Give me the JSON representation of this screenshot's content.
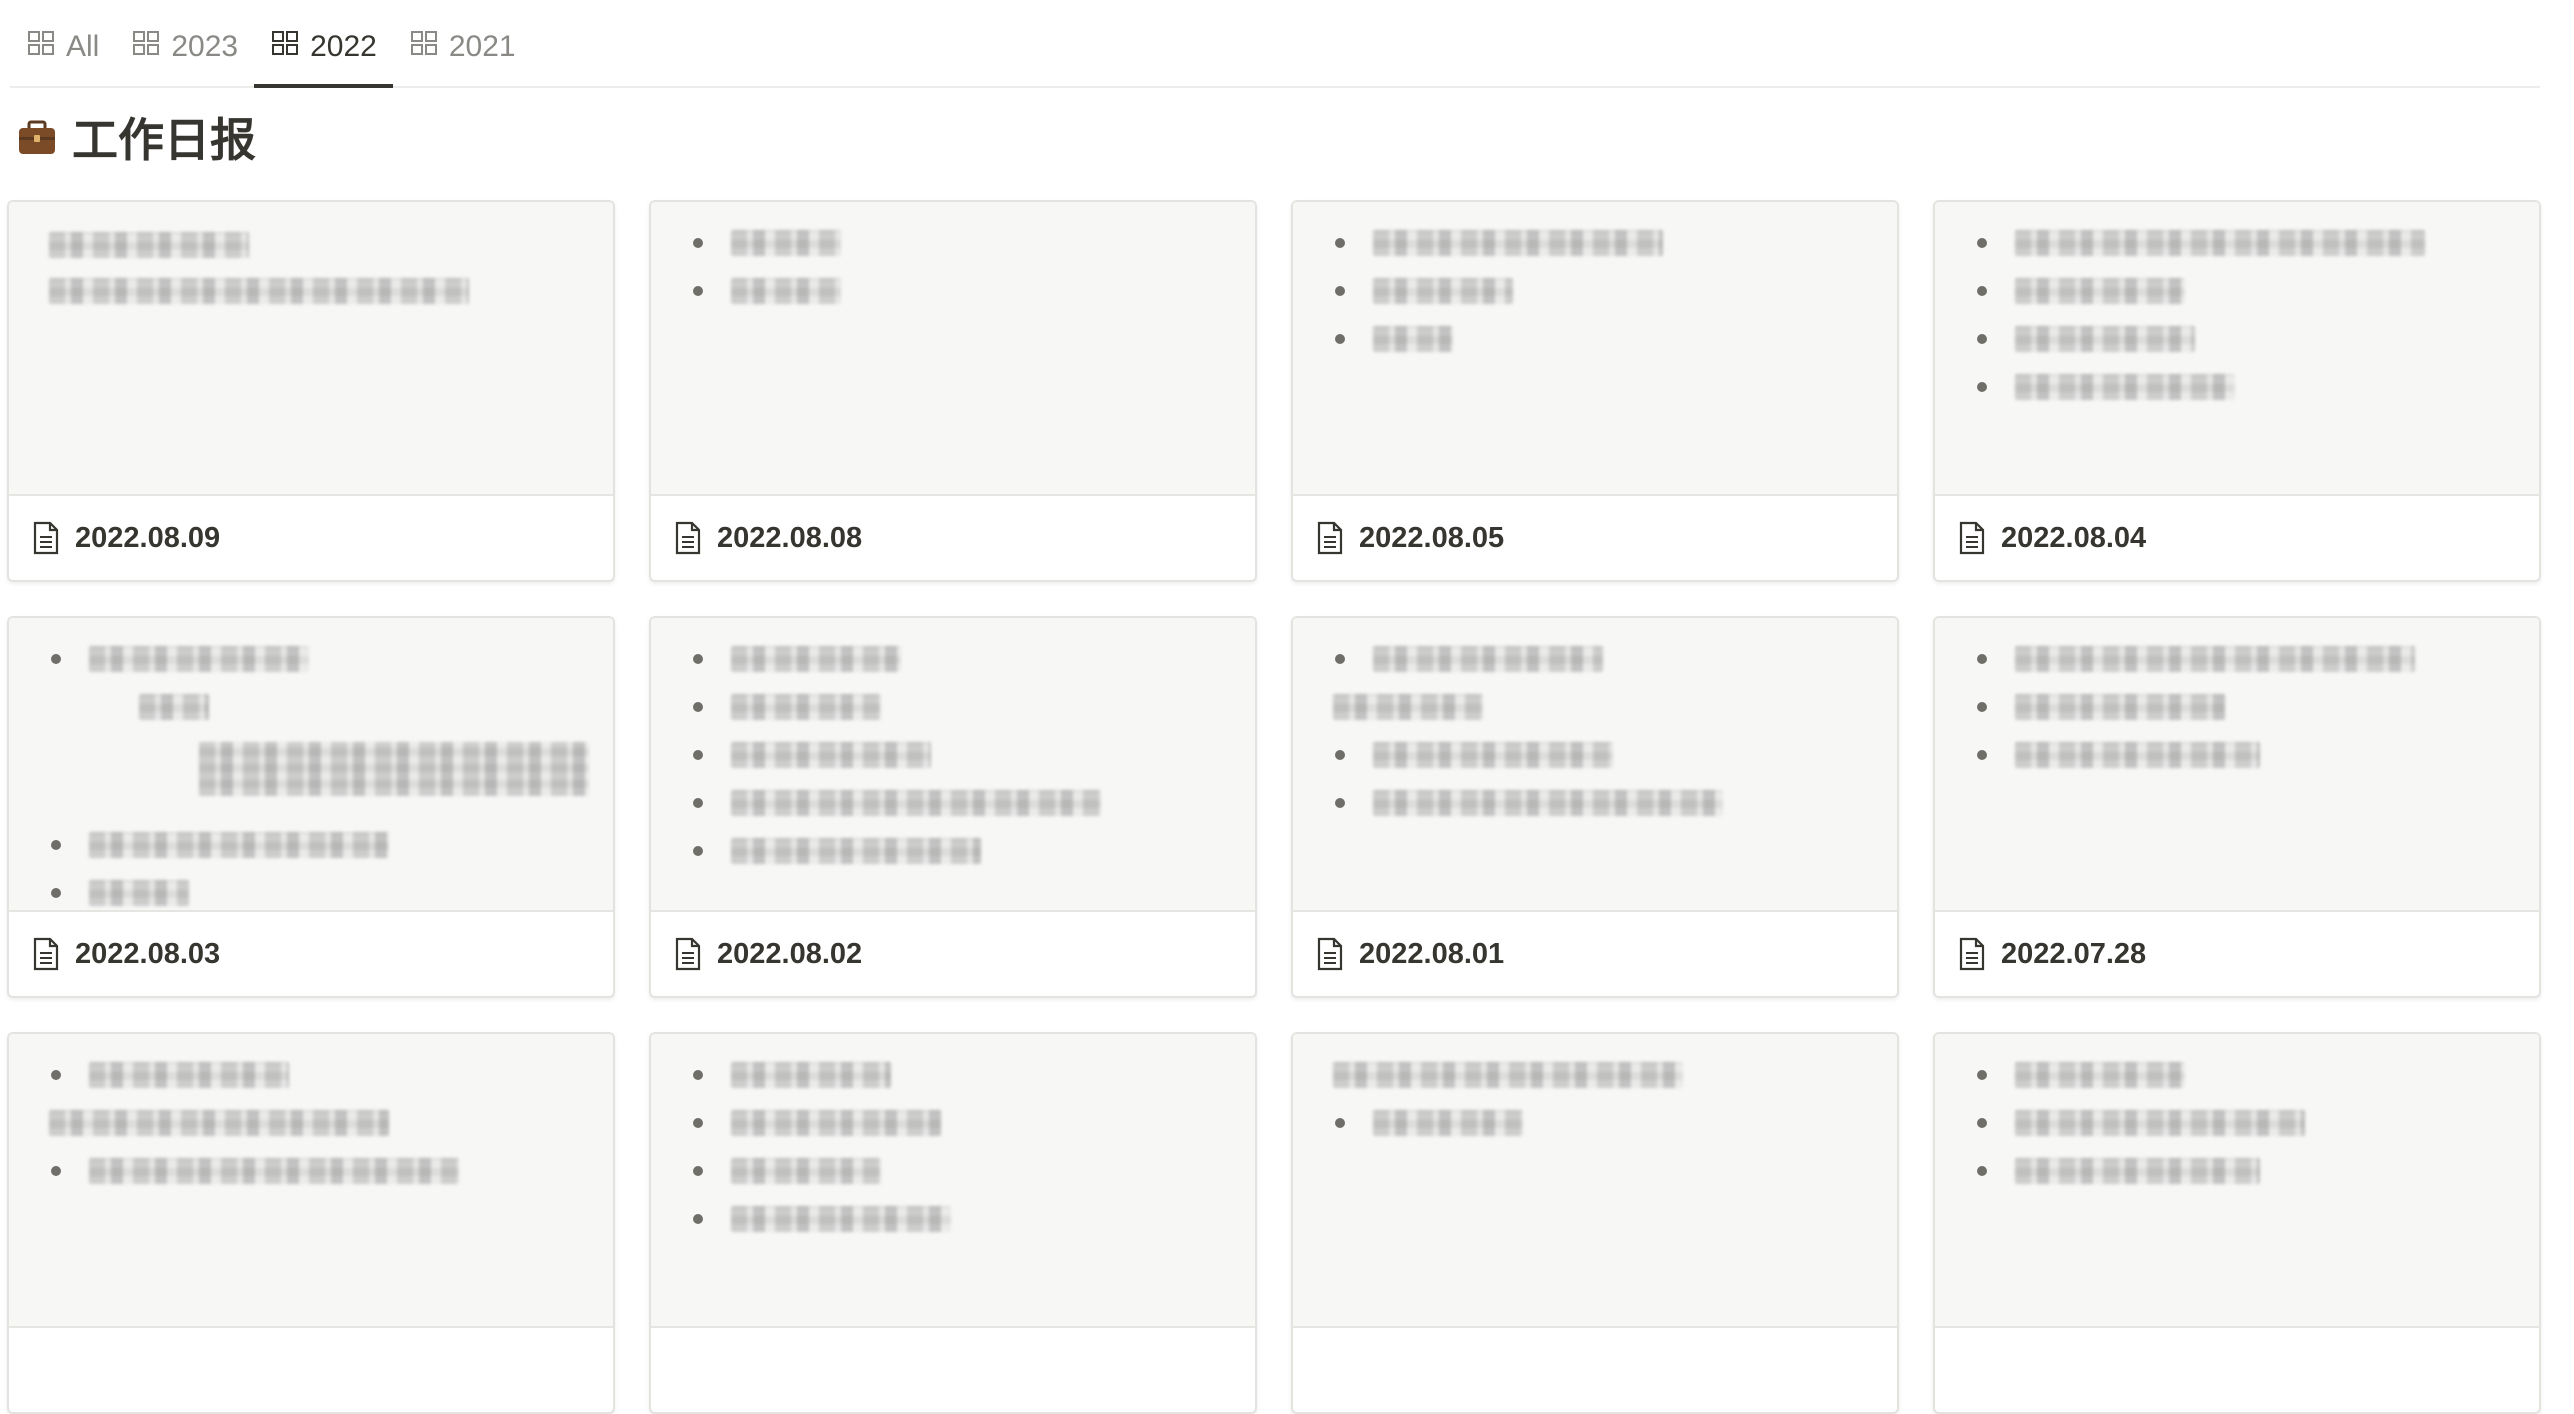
{
  "tabs": [
    {
      "label": "All",
      "icon": "gallery-icon",
      "active": false
    },
    {
      "label": "2023",
      "icon": "gallery-icon",
      "active": false
    },
    {
      "label": "2022",
      "icon": "gallery-icon",
      "active": true
    },
    {
      "label": "2021",
      "icon": "gallery-icon",
      "active": false
    }
  ],
  "page": {
    "emoji": "briefcase-icon",
    "title": "工作日报"
  },
  "cards": [
    {
      "title": "2022.08.09",
      "icon": "page-icon"
    },
    {
      "title": "2022.08.08",
      "icon": "page-icon"
    },
    {
      "title": "2022.08.05",
      "icon": "page-icon"
    },
    {
      "title": "2022.08.04",
      "icon": "page-icon"
    },
    {
      "title": "2022.08.03",
      "icon": "page-icon"
    },
    {
      "title": "2022.08.02",
      "icon": "page-icon"
    },
    {
      "title": "2022.08.01",
      "icon": "page-icon"
    },
    {
      "title": "2022.07.28",
      "icon": "page-icon"
    }
  ],
  "partial_cards_visible": 4,
  "colors": {
    "text": "#37352f",
    "muted": "#8a8985",
    "preview_bg": "#f7f7f6",
    "border": "#e4e3e0"
  }
}
